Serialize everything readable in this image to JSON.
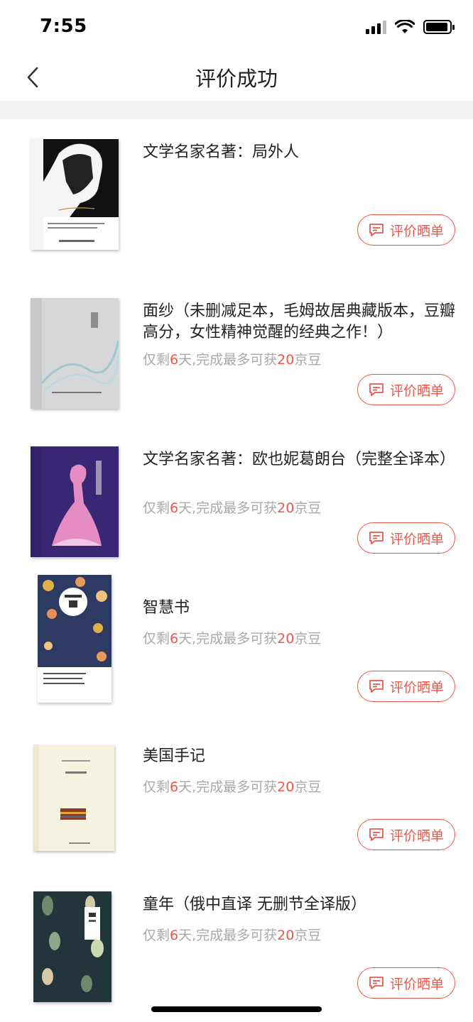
{
  "status_bar": {
    "time": "7:55"
  },
  "nav": {
    "title": "评价成功"
  },
  "reward_template": {
    "prefix": "仅剩",
    "days": "6",
    "mid": "天,完成最多可获",
    "beans": "20",
    "suffix": "京豆"
  },
  "button_label": "评价晒单",
  "items": [
    {
      "title": "文学名家名著：局外人",
      "show_reward": false,
      "cover_icon": "book-cover-lettranger"
    },
    {
      "title": "面纱（未删减足本，毛姆故居典藏版本，豆瓣高分，女性精神觉醒的经典之作！）",
      "show_reward": true,
      "cover_icon": "book-cover-veil"
    },
    {
      "title": "文学名家名著：欧也妮葛朗台（完整全译本）",
      "show_reward": true,
      "cover_icon": "book-cover-grandet"
    },
    {
      "title": "智慧书",
      "show_reward": true,
      "cover_icon": "book-cover-wisdom"
    },
    {
      "title": "美国手记",
      "show_reward": true,
      "cover_icon": "book-cover-american-notes"
    },
    {
      "title": "童年（俄中直译 无删节全译版）",
      "show_reward": true,
      "cover_icon": "book-cover-childhood"
    }
  ],
  "colors": {
    "accent": "#e8574c",
    "muted_text": "#a9a9a9",
    "divider": "#f3f3f3"
  },
  "icons": {
    "back": "chevron-left-icon",
    "review": "chat-bubble-icon"
  }
}
